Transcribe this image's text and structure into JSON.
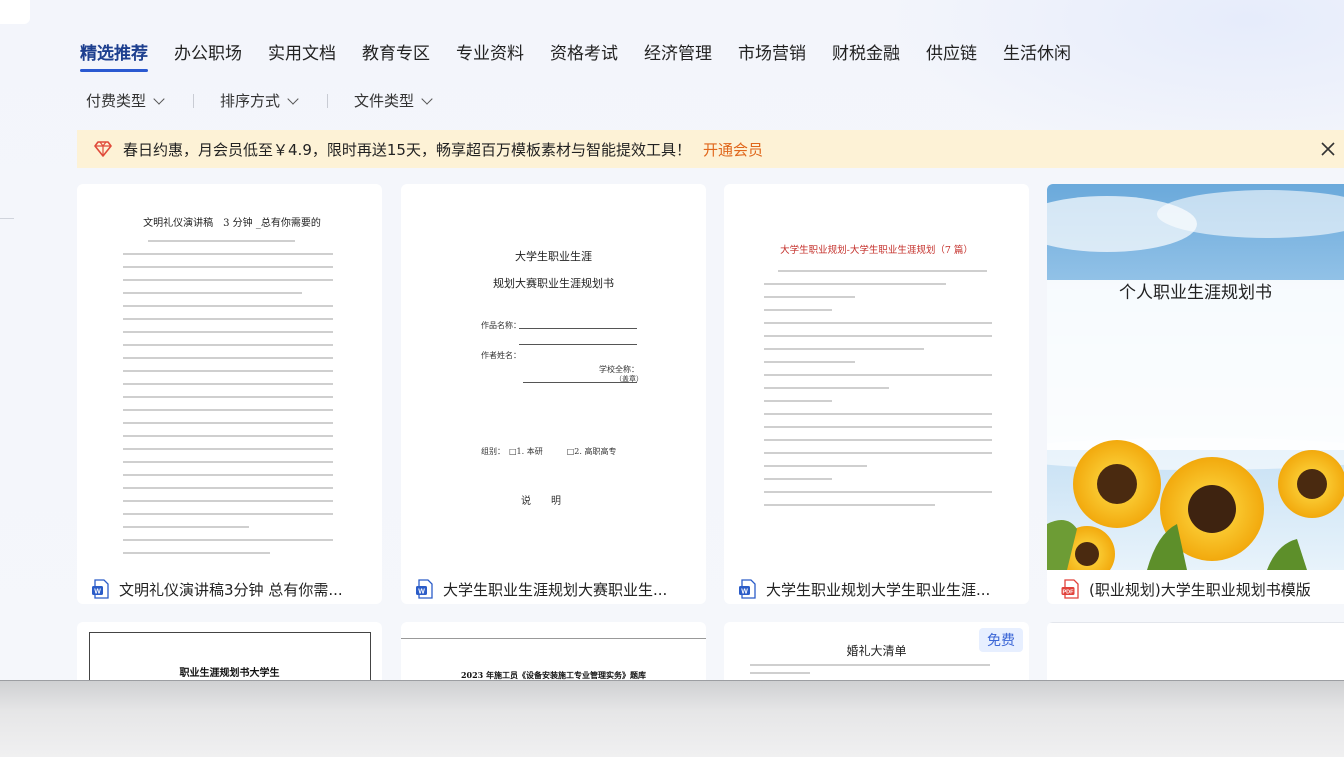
{
  "nav": {
    "tabs": [
      {
        "label": "精选推荐",
        "active": true
      },
      {
        "label": "办公职场"
      },
      {
        "label": "实用文档"
      },
      {
        "label": "教育专区"
      },
      {
        "label": "专业资料"
      },
      {
        "label": "资格考试"
      },
      {
        "label": "经济管理"
      },
      {
        "label": "市场营销"
      },
      {
        "label": "财税金融"
      },
      {
        "label": "供应链"
      },
      {
        "label": "生活休闲"
      }
    ]
  },
  "filters": {
    "pay_type": "付费类型",
    "sort": "排序方式",
    "file_type": "文件类型"
  },
  "banner": {
    "text": "春日约惠，月会员低至￥4.9，限时再送15天，畅享超百万模板素材与智能提效工具！",
    "link": "开通会员"
  },
  "cards": [
    {
      "title": "文明礼仪演讲稿3分钟 总有你需...",
      "file_type": "word",
      "thumb_title": "文明礼仪演讲稿　3 分钟 _总有你需要的"
    },
    {
      "title": "大学生职业生涯规划大赛职业生...",
      "file_type": "word",
      "thumb_title": "大学生职业生涯",
      "thumb_subtitle": "规划大赛职业生涯规划书",
      "thumb_field1": "作品名称：",
      "thumb_field2": "作者姓名：",
      "thumb_field3": "学校全称：",
      "thumb_seal": "（盖章）",
      "thumb_group": "组别：　□1. 本研　　　□2. 高职高专",
      "thumb_explain": "说　　明"
    },
    {
      "title": "大学生职业规划大学生职业生涯...",
      "file_type": "word",
      "thumb_title": "大学生职业规划-大学生职业生涯规划（7 篇）"
    },
    {
      "title": "(职业规划)大学生职业规划书模版",
      "file_type": "pdf",
      "thumb_title": "个人职业生涯规划书"
    }
  ],
  "row2": [
    {
      "thumb_title": "职业生涯规划书大学生"
    },
    {
      "thumb_title": "2023 年施工员《设备安装施工专业管理实务》题库"
    },
    {
      "thumb_title": "婚礼大清单",
      "badge": "免费"
    },
    {
      "thumb_title": ""
    }
  ],
  "colors": {
    "accent": "#2a59d1",
    "banner_bg": "#fdf2d6",
    "link": "#e0671c",
    "word": "#2b5cc8",
    "pdf": "#e1413a"
  }
}
